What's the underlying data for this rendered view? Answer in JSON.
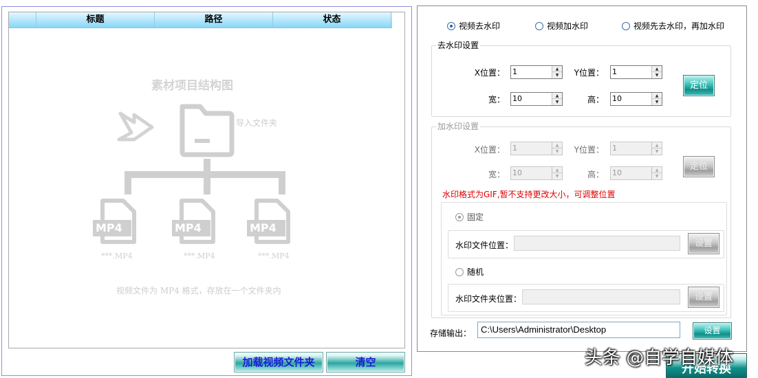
{
  "list": {
    "columns": [
      "标题",
      "路径",
      "状态"
    ]
  },
  "illustration": {
    "title": "素材项目结构图",
    "import_folder_label": "导入文件夹",
    "file_badge": "MP4",
    "file_captions": [
      "***.MP4",
      "***.MP4",
      "***.MP4"
    ],
    "hint": "视频文件为 MP4 格式，存放在一个文件夹内"
  },
  "left_buttons": {
    "load_folder": "加载视频文件夹",
    "clear": "清空"
  },
  "mode": {
    "options": [
      "视频去水印",
      "视频加水印",
      "视频先去水印，再加水印"
    ],
    "selected": "视频去水印"
  },
  "remove_group": {
    "legend": "去水印设置",
    "x_label": "X位置：",
    "y_label": "Y位置：",
    "w_label": "宽：",
    "h_label": "高：",
    "x": "1",
    "y": "1",
    "w": "10",
    "h": "10",
    "locate_button": "定位"
  },
  "add_group": {
    "legend": "加水印设置",
    "x_label": "X位置：",
    "y_label": "Y位置：",
    "w_label": "宽：",
    "h_label": "高：",
    "x": "1",
    "y": "1",
    "w": "10",
    "h": "10",
    "locate_button": "定位",
    "note": "水印格式为GIF,暂不支持更改大小，可调整位置",
    "fixed_label": "固定",
    "random_label": "随机",
    "file_label": "水印文件位置：",
    "folder_label": "水印文件夹位置：",
    "set_button": "设置"
  },
  "output": {
    "label": "存储输出：",
    "path": "C:\\Users\\Administrator\\Desktop",
    "set_button": "设置"
  },
  "start_button": "开始转换",
  "overlay_caption": "头条 @自学自媒体",
  "colors": {
    "header_gradient_top": "#e4f7ff",
    "header_gradient_bottom": "#88d7f7",
    "teal_button": "#0f8f8a",
    "note_red": "#e00000",
    "panel_border": "#9090e0"
  }
}
